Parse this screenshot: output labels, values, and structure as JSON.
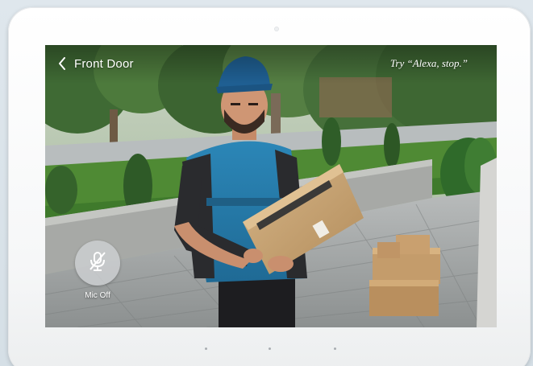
{
  "header": {
    "title": "Front Door",
    "back_icon": "chevron-left-icon",
    "hint": "Try “Alexa, stop.”"
  },
  "controls": {
    "mic": {
      "icon": "mic-off-icon",
      "label": "Mic Off"
    }
  },
  "pagination": {
    "page_count": 3
  },
  "colors": {
    "text": "#ffffff",
    "mic_button_bg": "#cdd0d2",
    "bezel": "#ffffff",
    "page_dot": "#a9adb1"
  }
}
